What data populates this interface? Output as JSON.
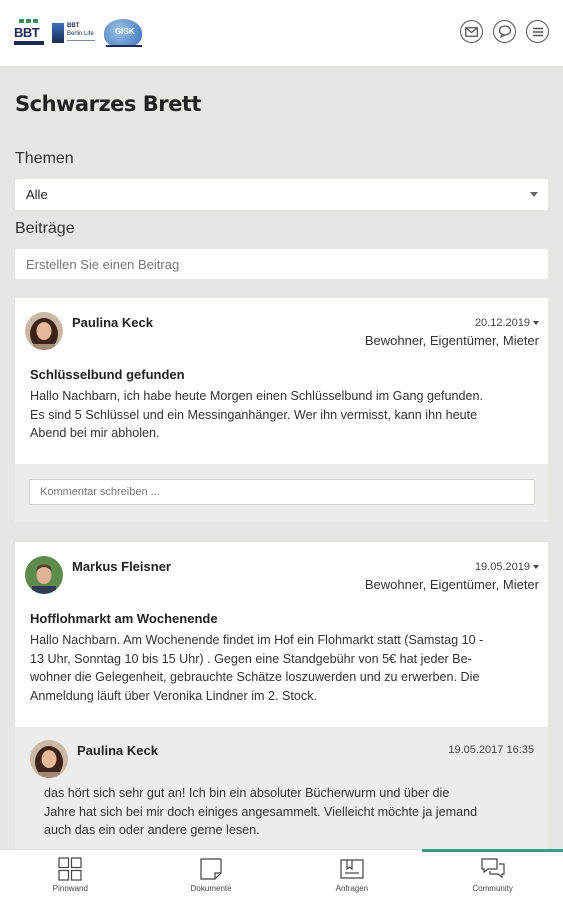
{
  "header": {
    "logos": [
      "BBT",
      "BBT Berlin Life",
      "GISK"
    ],
    "icons": [
      "mail-icon",
      "chat-icon",
      "menu-icon"
    ]
  },
  "page_title": "Schwarzes Brett",
  "themes": {
    "label": "Themen",
    "selected": "Alle"
  },
  "posts_section": {
    "label": "Beiträge",
    "placeholder": "Erstellen Sie einen Beitrag"
  },
  "posts": [
    {
      "author": "Paulina Keck",
      "date": "20.12.2019",
      "roles": "Bewohner, Eigentümer, Mieter",
      "title": "Schlüsselbund gefunden",
      "body": [
        "Hallo Nachbarn, ich habe heute Morgen einen Schlüsselbund im Gang gefunden.",
        "Es sind 5 Schlüssel und ein Messinganhänger. Wer ihn vermisst, kann ihn heute",
        "Abend bei mir abholen."
      ],
      "comment_placeholder": "Kommentar schreiben ..."
    },
    {
      "author": "Markus Fleisner",
      "date": "19.05.2019",
      "roles": "Bewohner, Eigentümer, Mieter",
      "title": "Hofflohmarkt am Wochenende",
      "body": [
        "Hallo Nachbarn. Am Wochenende findet im Hof ein Flohmarkt statt (Samstag 10 -",
        "13 Uhr, Sonntag 10 bis 15 Uhr) . Gegen eine Standgebühr von 5€ hat jeder Be-",
        "wohner die Gelegenheit, gebrauchte Schätze loszuwerden und zu erwerben. Die",
        "Anmeldung läuft über Veronika Lindner im 2. Stock."
      ],
      "reply": {
        "author": "Paulina Keck",
        "date": "19.05.2017 16:35",
        "body": [
          "das hört sich sehr gut an! Ich bin ein absoluter Bücherwurm und über die",
          "Jahre hat sich bei mir doch einiges angesammelt. Vielleicht möchte ja jemand",
          "auch das ein oder andere gerne lesen."
        ]
      }
    }
  ],
  "tabs": [
    {
      "label": "Pinnwand",
      "icon": "grid-icon"
    },
    {
      "label": "Dokumente",
      "icon": "document-icon"
    },
    {
      "label": "Anfragen",
      "icon": "inbox-icon"
    },
    {
      "label": "Community",
      "icon": "community-chat-icon",
      "active": true
    }
  ],
  "colors": {
    "accent": "#3a9c86",
    "background": "#e6e6e3",
    "navy": "#1c2a55"
  }
}
